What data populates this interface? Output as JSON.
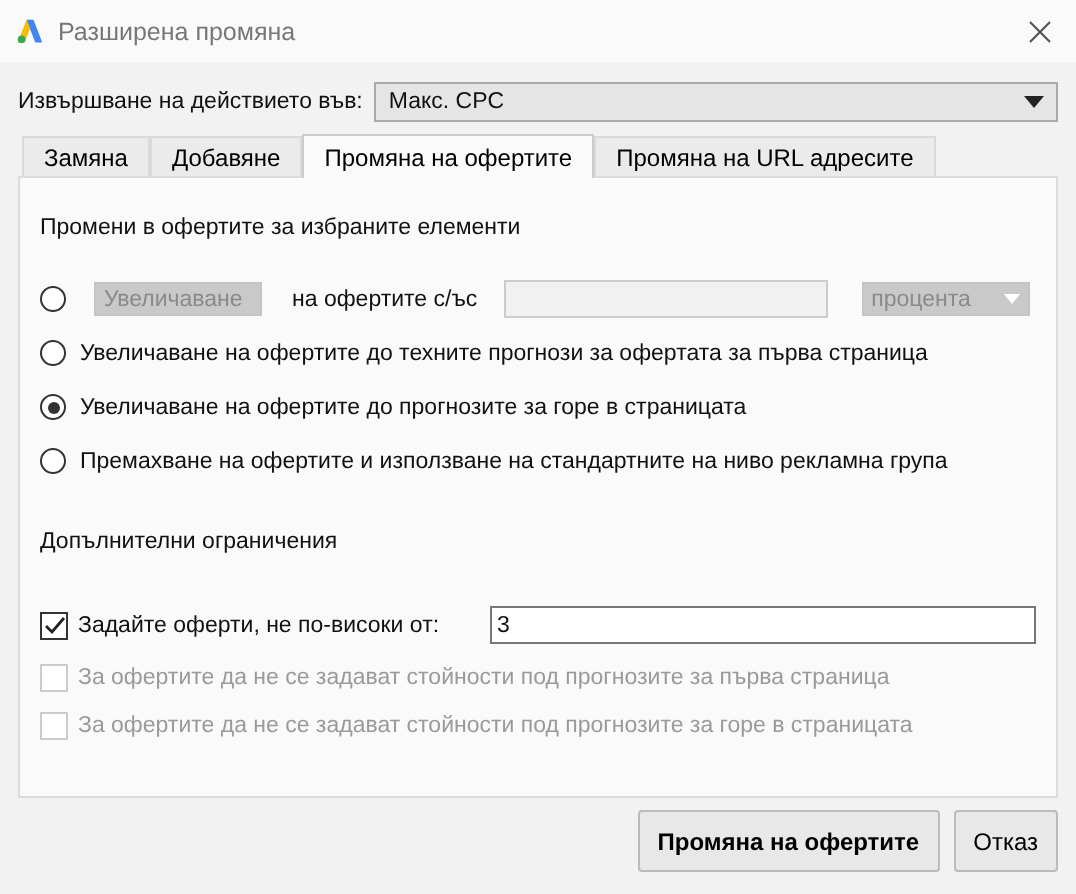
{
  "window": {
    "title": "Разширена промяна"
  },
  "action": {
    "label": "Извършване на действието във:",
    "value": "Макс. CPC"
  },
  "tabs": [
    {
      "label": "Замяна",
      "selected": false
    },
    {
      "label": "Добавяне",
      "selected": false
    },
    {
      "label": "Промяна на офертите",
      "selected": true
    },
    {
      "label": "Промяна на URL адресите",
      "selected": false
    }
  ],
  "bid_changes": {
    "title": "Промени в офертите за избраните елементи",
    "options": [
      {
        "kind": "adjust",
        "selected": false,
        "disabled": true,
        "direction": "Увеличаване",
        "connector": "на офертите с/ъс",
        "unit": "процента"
      },
      {
        "kind": "text",
        "selected": false,
        "label": "Увеличаване на офертите до техните прогнози за офертата за първа страница"
      },
      {
        "kind": "text",
        "selected": true,
        "label": "Увеличаване на офертите до прогнозите за горе в страницата"
      },
      {
        "kind": "text",
        "selected": false,
        "label": "Премахване на офертите и използване на стандартните на ниво рекламна група"
      }
    ]
  },
  "limits": {
    "title": "Допълнителни ограничения",
    "items": [
      {
        "kind": "value",
        "checked": true,
        "disabled": false,
        "label": "Задайте оферти, не по-високи от:",
        "value": "3"
      },
      {
        "kind": "plain",
        "checked": false,
        "disabled": true,
        "label": "За офертите да не се задават стойности под прогнозите за първа страница"
      },
      {
        "kind": "plain",
        "checked": false,
        "disabled": true,
        "label": "За офертите да не се задават стойности под прогнозите за горе в страницата"
      }
    ]
  },
  "buttons": [
    {
      "label": "Промяна на офертите",
      "primary": true
    },
    {
      "label": "Отказ",
      "primary": false
    }
  ]
}
